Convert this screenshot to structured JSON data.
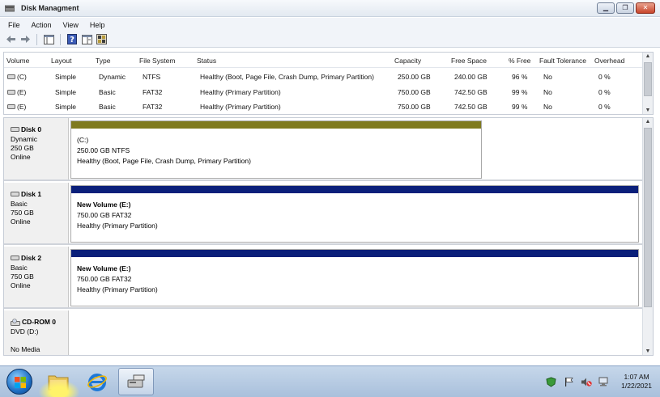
{
  "window": {
    "title": "Disk Managment",
    "title_icon": "disk-management-icon",
    "buttons": [
      "minimize-icon",
      "maximize-icon",
      "close-icon"
    ]
  },
  "menu": [
    "File",
    "Action",
    "View",
    "Help"
  ],
  "toolbar_icons": [
    "back-arrow-icon",
    "forward-arrow-icon",
    "console-tree-icon",
    "help-icon",
    "properties-icon",
    "settings-grid-icon"
  ],
  "volume_list": {
    "columns": [
      "Volume",
      "Layout",
      "Type",
      "File System",
      "Status",
      "Capacity",
      "Free Space",
      "% Free",
      "Fault Tolerance",
      "Overhead"
    ],
    "rows": [
      [
        "(C)",
        "Simple",
        "Dynamic",
        "NTFS",
        "Healthy (Boot, Page File, Crash Dump, Primary Partition)",
        "250.00 GB",
        "240.00 GB",
        "96 %",
        "No",
        "0 %"
      ],
      [
        "(E)",
        "Simple",
        "Basic",
        "FAT32",
        "Healthy (Primary Partition)",
        "750.00 GB",
        "742.50 GB",
        "99 %",
        "No",
        "0 %"
      ],
      [
        "(E)",
        "Simple",
        "Basic",
        "FAT32",
        "Healthy (Primary Partition)",
        "750.00 GB",
        "742.50 GB",
        "99 %",
        "No",
        "0 %"
      ]
    ]
  },
  "disks": [
    {
      "name": "Disk 0",
      "type": "Dynamic",
      "size": "250 GB",
      "state": "Online",
      "partition": {
        "name": "(C:)",
        "size_fs": "250.00 GB  NTFS",
        "status": "Healthy (Boot, Page File, Crash Dump, Primary Partition)",
        "bar_color": "#7f7a1f"
      }
    },
    {
      "name": "Disk 1",
      "type": "Basic",
      "size": "750 GB",
      "state": "Online",
      "partition": {
        "name": "New Volume (E:)",
        "size_fs": "750.00 GB  FAT32",
        "status": "Healthy (Primary Partition)",
        "bar_color": "#0a1f7a"
      }
    },
    {
      "name": "Disk 2",
      "type": "Basic",
      "size": "750 GB",
      "state": "Online",
      "partition": {
        "name": "New Volume (E:)",
        "size_fs": "750.00 GB  FAT32",
        "status": "Healthy (Primary Partition)",
        "bar_color": "#0a1f7a"
      }
    }
  ],
  "cdrom": {
    "name": "CD-ROM 0",
    "type": "DVD (D:)",
    "state": "No Media"
  },
  "taskbar": {
    "apps": [
      "start-orb-icon",
      "file-explorer-icon",
      "internet-explorer-icon",
      "disk-management-app-icon"
    ],
    "tray_icons": [
      "security-shield-icon",
      "action-center-flag-icon",
      "volume-muted-icon",
      "network-icon"
    ],
    "time": "1:07 AM",
    "date": "1/22/2021"
  }
}
